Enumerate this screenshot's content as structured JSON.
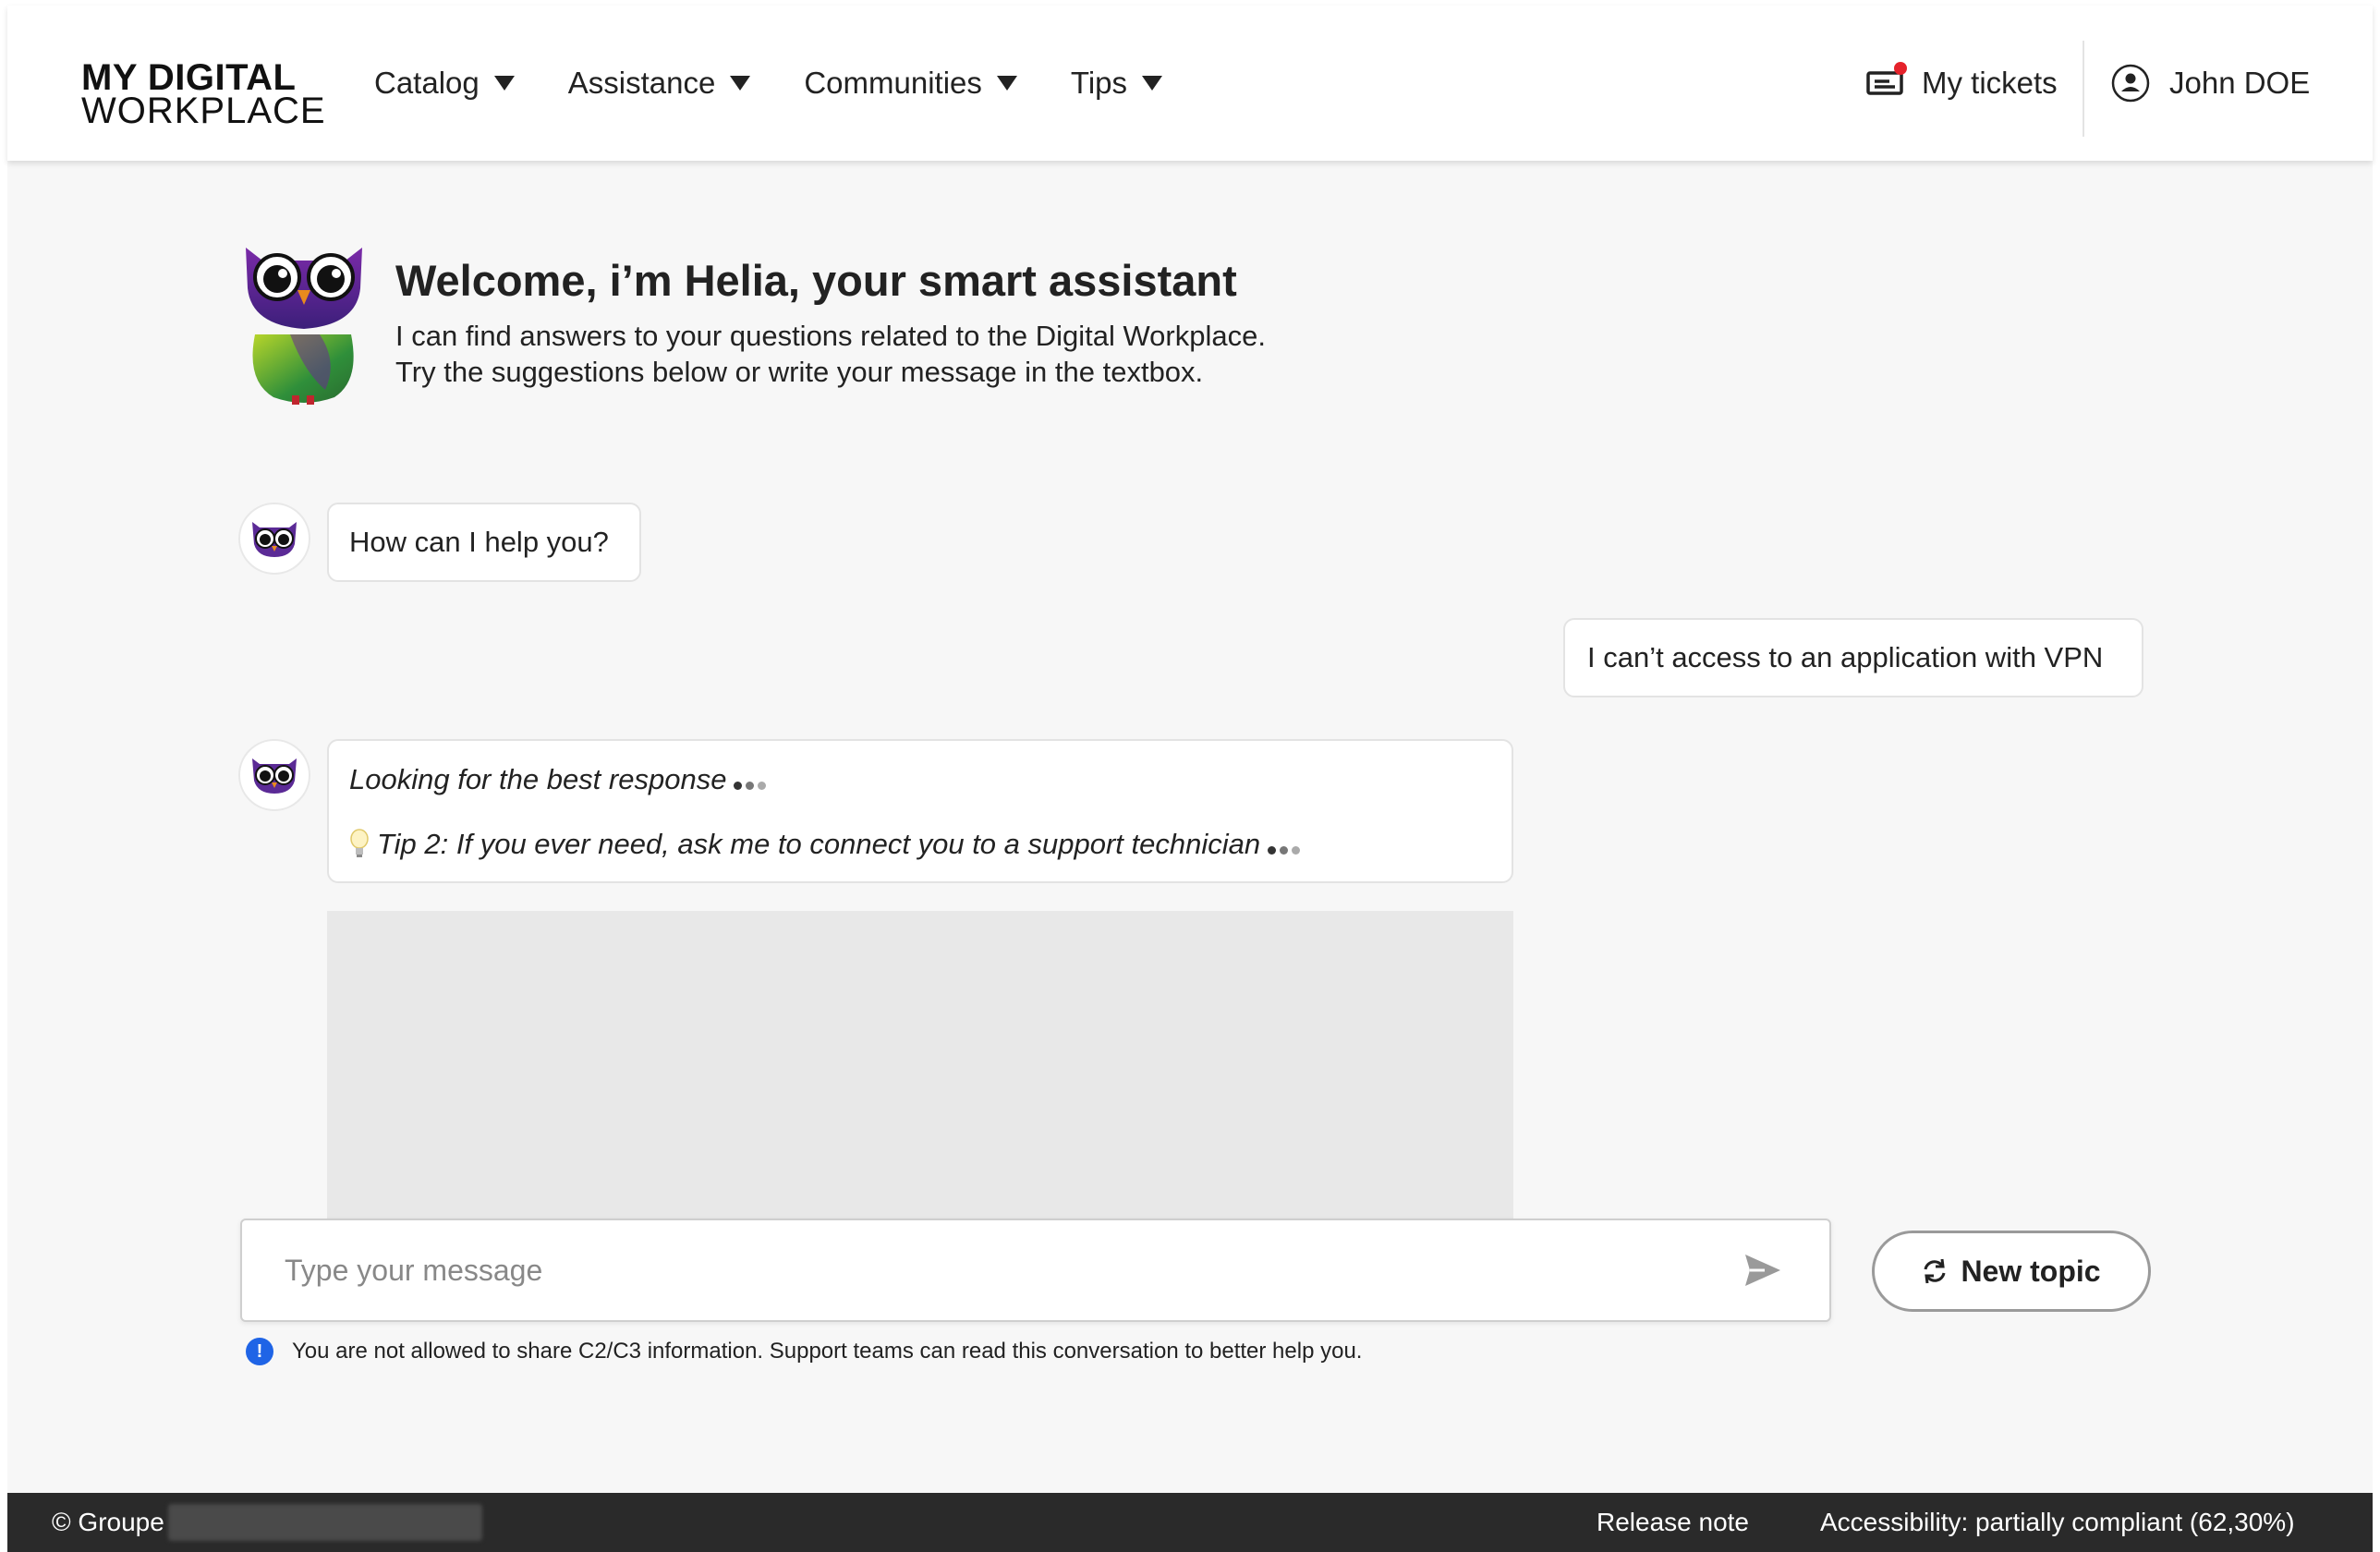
{
  "header": {
    "logo_line1": "MY DIGITAL",
    "logo_line2": "WORKPLACE",
    "nav": [
      {
        "label": "Catalog"
      },
      {
        "label": "Assistance"
      },
      {
        "label": "Communities"
      },
      {
        "label": "Tips"
      }
    ],
    "tickets_label": "My tickets",
    "user_name": "John DOE"
  },
  "welcome": {
    "title": "Welcome, i’m Helia, your smart assistant",
    "line1": "I can find answers to your questions related to the Digital Workplace.",
    "line2": "Try the suggestions below or write your message in the textbox."
  },
  "chat": {
    "bot_message_1": "How can I help you?",
    "user_message_1": "I can’t access to an application with VPN",
    "bot_loading": "Looking for the best response",
    "bot_tip": "Tip 2: If you ever need, ask me to connect you to a support technician"
  },
  "composer": {
    "placeholder": "Type your message",
    "new_topic_label": "New topic",
    "notice": "You are not allowed to share C2/C3 information. Support teams can read this conversation to better help you."
  },
  "footer": {
    "copyright": "© Groupe",
    "release_note": "Release note",
    "accessibility": "Accessibility: partially compliant (62,30%)"
  },
  "colors": {
    "accent_blue": "#1f64e6",
    "notification_red": "#e5222b",
    "footer_bg": "#2a2a2a",
    "page_bg": "#f7f7f7"
  },
  "icons": [
    "caret-down-icon",
    "ticket-icon",
    "user-circle-icon",
    "owl-avatar-icon",
    "lightbulb-icon",
    "send-icon",
    "refresh-icon",
    "info-icon"
  ]
}
